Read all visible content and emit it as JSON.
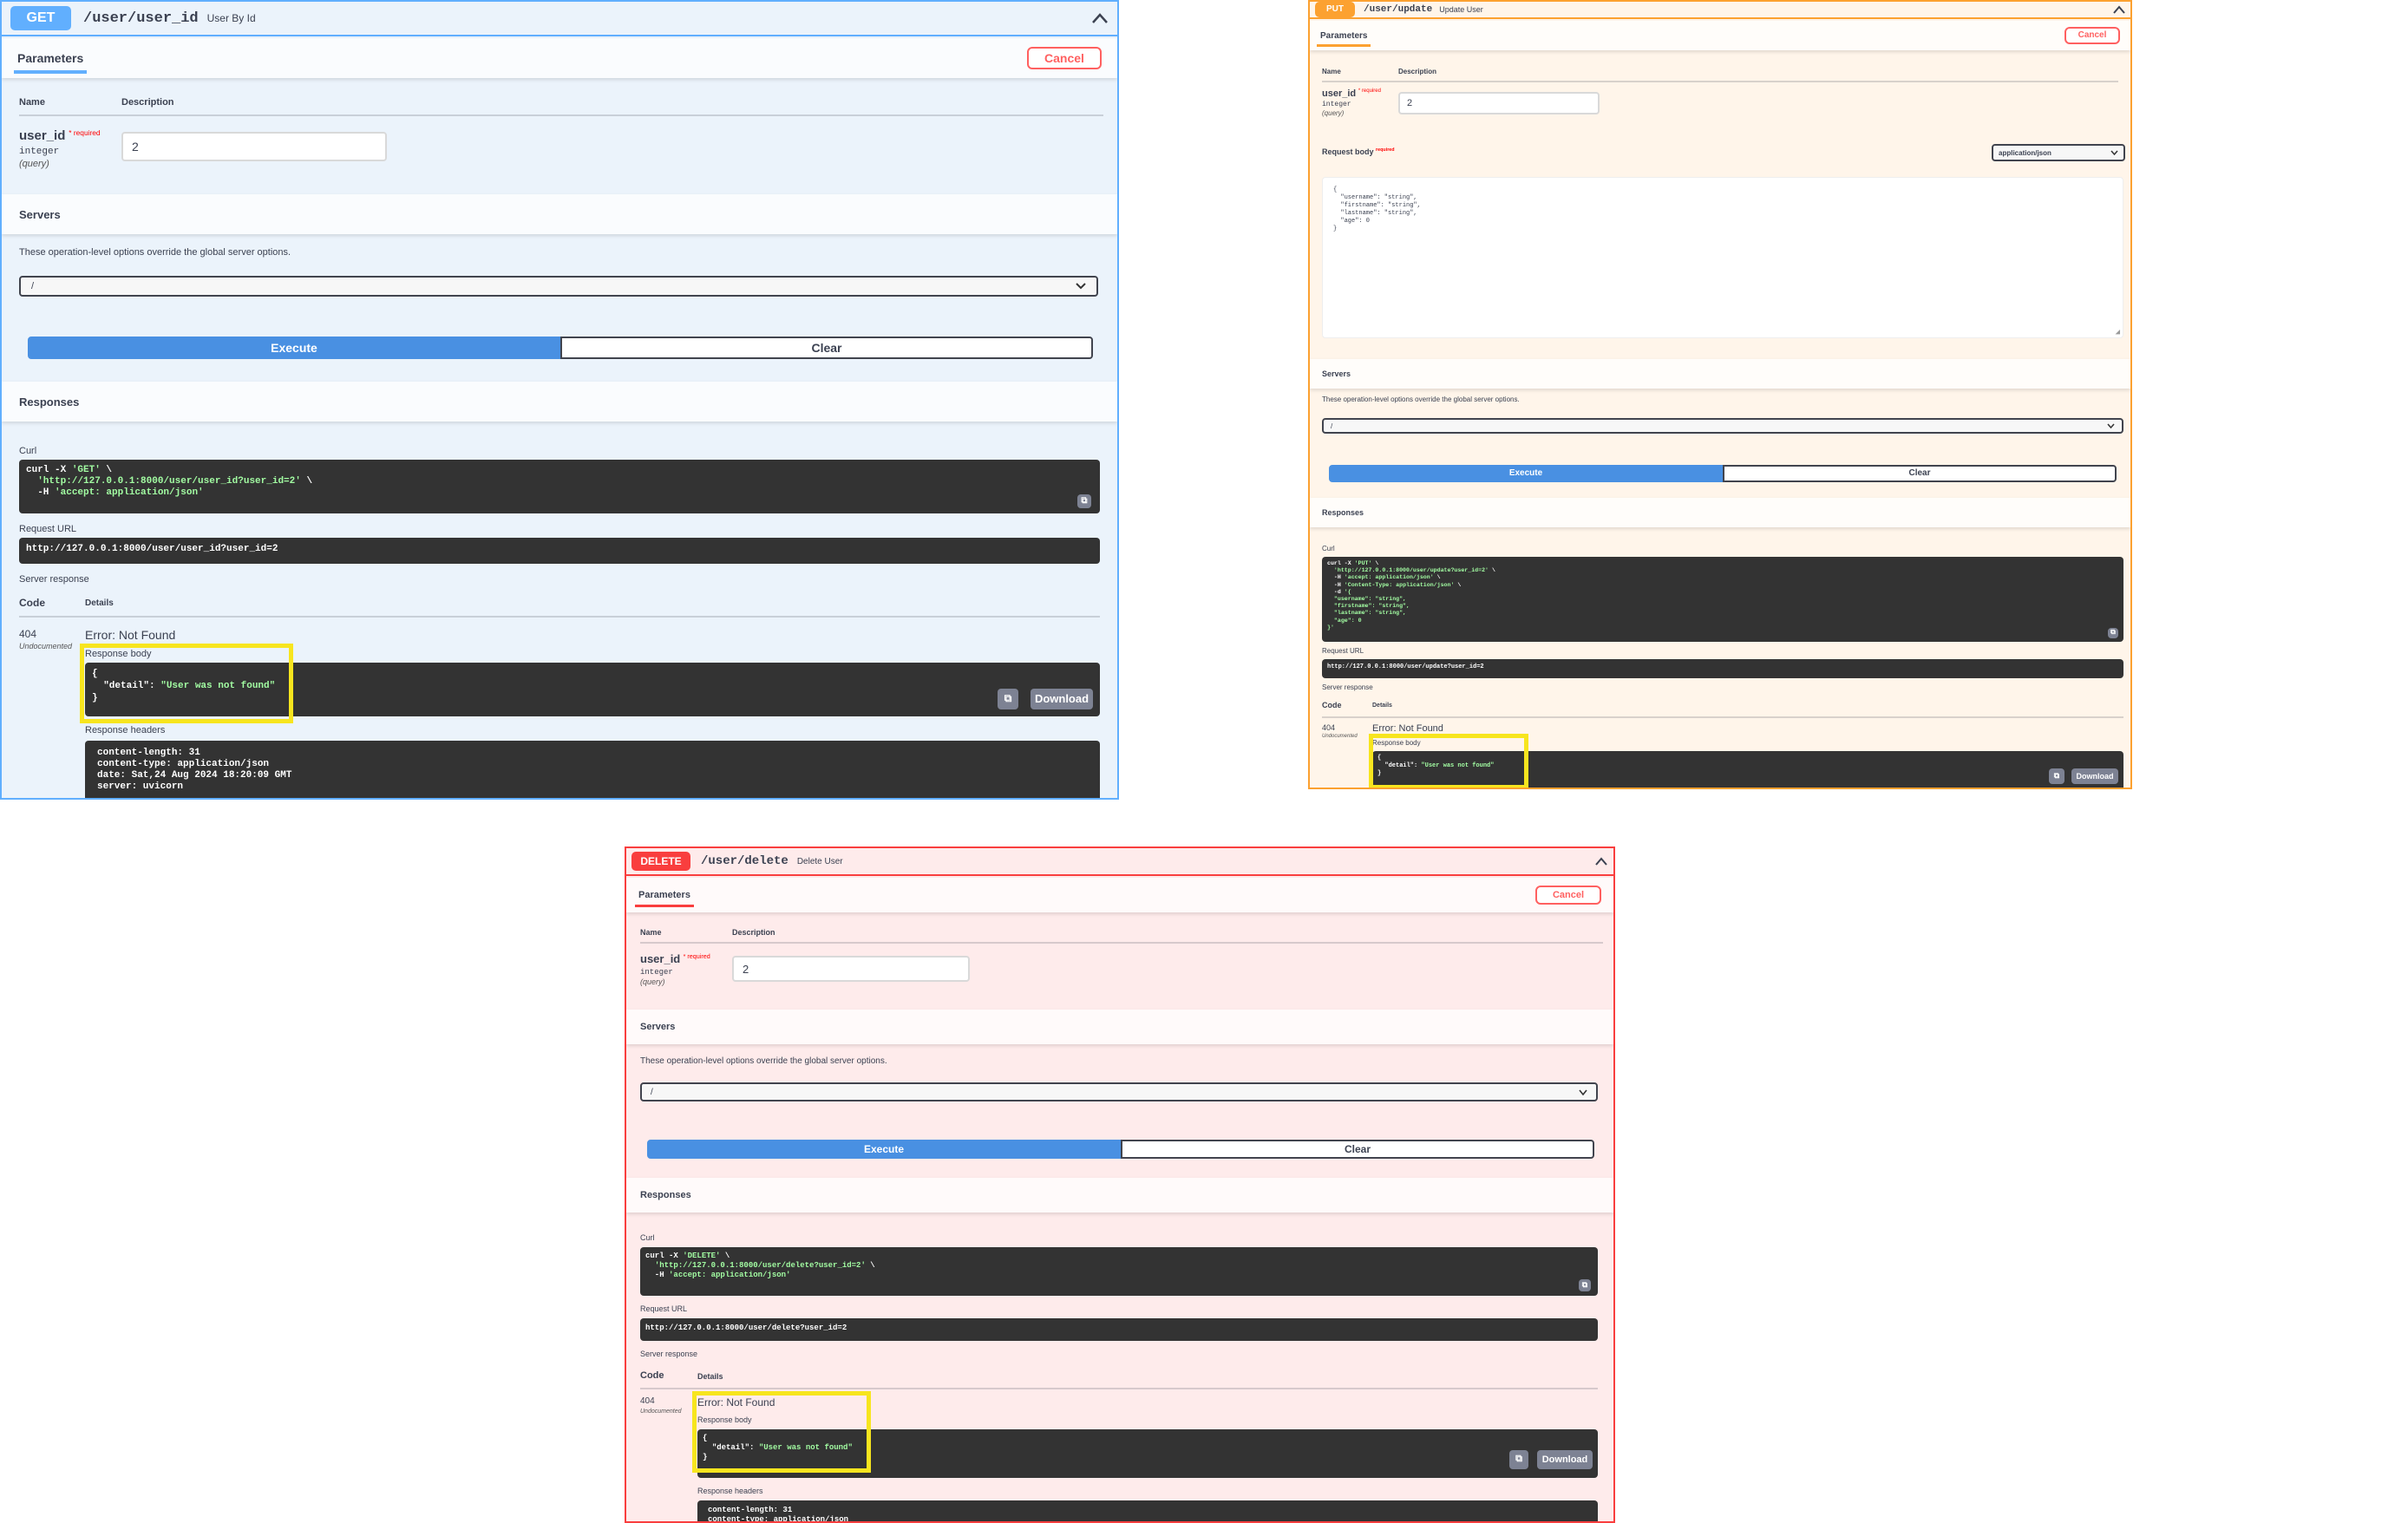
{
  "common": {
    "parameters_tab": "Parameters",
    "cancel": "Cancel",
    "name_col": "Name",
    "description_col": "Description",
    "param_name": "user_id",
    "required_mark": "* required",
    "param_type": "integer",
    "param_in": "(query)",
    "param_value": "2",
    "servers_title": "Servers",
    "servers_note": "These operation-level options override the global server options.",
    "server_selected": "/",
    "execute": "Execute",
    "clear": "Clear",
    "responses_title": "Responses",
    "curl_label": "Curl",
    "request_url_label": "Request URL",
    "server_response_label": "Server response",
    "code_col": "Code",
    "details_col": "Details",
    "status_code": "404",
    "status_note": "Undocumented",
    "error_text": "Error: Not Found",
    "response_body_label": "Response body",
    "body_open": "{",
    "body_key": "\"detail\": ",
    "body_value": "\"User was not found\"",
    "body_close": "}",
    "download": "Download",
    "response_headers_label": "Response headers",
    "header_content_length": "content-length: 31",
    "header_content_type": "content-type: application/json",
    "header_date": "date: Sat,24 Aug 2024 18:20:09 GMT",
    "header_server": "server: uvicorn"
  },
  "get_panel": {
    "method": "GET",
    "path": "/user/user_id",
    "summary": "User By Id",
    "curl_line1": "curl -X ",
    "curl_method": "'GET'",
    "curl_line1_end": " \\",
    "curl_url": "'http://127.0.0.1:8000/user/user_id?user_id=2'",
    "curl_line2_end": " \\",
    "curl_line3_a": "  -H ",
    "curl_header": "'accept: application/json'",
    "request_url": "http://127.0.0.1:8000/user/user_id?user_id=2",
    "colors": {
      "accent": "#61affe",
      "bg": "#ebf3fb",
      "border": "#61affe"
    }
  },
  "put_panel": {
    "method": "PUT",
    "path": "/user/update",
    "summary": "Update User",
    "request_body_label": "Request body",
    "required_mark": "required",
    "content_type": "application/json",
    "body_lines": [
      "{",
      "  \"username\": \"string\",",
      "  \"firstname\": \"string\",",
      "  \"lastname\": \"string\",",
      "  \"age\": 0",
      "}"
    ],
    "curl_lines": [
      [
        "curl -X ",
        "'PUT'",
        " \\"
      ],
      [
        "  ",
        "'http://127.0.0.1:8000/user/update?user_id=2'",
        " \\"
      ],
      [
        "  -H ",
        "'accept: application/json'",
        " \\"
      ],
      [
        "  -H ",
        "'Content-Type: application/json'",
        " \\"
      ],
      [
        "  -d ",
        "'{",
        ""
      ],
      [
        "  ",
        "\"username\": \"string\",",
        ""
      ],
      [
        "  ",
        "\"firstname\": \"string\",",
        ""
      ],
      [
        "  ",
        "\"lastname\": \"string\",",
        ""
      ],
      [
        "  ",
        "\"age\": 0",
        ""
      ],
      [
        "",
        "}'",
        ""
      ]
    ],
    "request_url": "http://127.0.0.1:8000/user/update?user_id=2",
    "colors": {
      "accent": "#fca130",
      "bg": "#fff5ea",
      "border": "#fca130"
    }
  },
  "delete_panel": {
    "method": "DELETE",
    "path": "/user/delete",
    "summary": "Delete User",
    "curl_line1": "curl -X ",
    "curl_method": "'DELETE'",
    "curl_line1_end": " \\",
    "curl_url": "'http://127.0.0.1:8000/user/delete?user_id=2'",
    "curl_line2_end": " \\",
    "curl_line3_a": "  -H ",
    "curl_header": "'accept: application/json'",
    "request_url": "http://127.0.0.1:8000/user/delete?user_id=2",
    "colors": {
      "accent": "#f93e3e",
      "bg": "#feebeb",
      "border": "#f93e3e"
    }
  },
  "icons": {
    "chevron_up": "chevron-up-icon",
    "chevron_down": "chevron-down-icon",
    "copy": "copy-icon",
    "resize": "resize-handle-icon"
  }
}
